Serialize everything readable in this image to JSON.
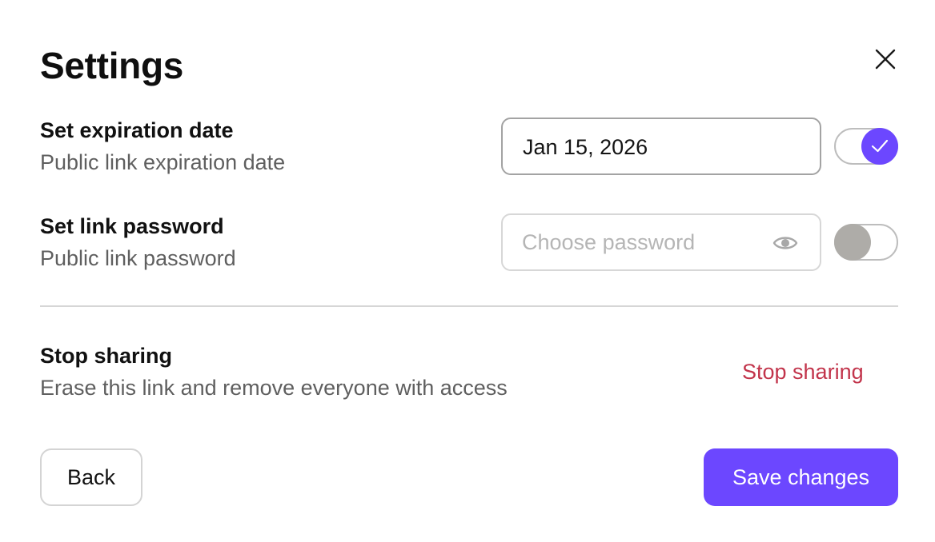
{
  "dialog": {
    "title": "Settings",
    "close_icon": "close-icon"
  },
  "expiration": {
    "title": "Set expiration date",
    "description": "Public link expiration date",
    "value": "Jan 15, 2026",
    "toggle_enabled": true,
    "toggle_icon": "check-icon"
  },
  "password": {
    "title": "Set link password",
    "description": "Public link password",
    "placeholder": "Choose password",
    "value": "",
    "visibility_icon": "eye-icon",
    "toggle_enabled": false
  },
  "stop_sharing": {
    "title": "Stop sharing",
    "description": "Erase this link and remove everyone with access",
    "action_label": "Stop sharing"
  },
  "footer": {
    "back_label": "Back",
    "save_label": "Save changes"
  },
  "colors": {
    "accent": "#6c47ff",
    "danger": "#c2344b",
    "toggle_off": "#aeaca8"
  }
}
